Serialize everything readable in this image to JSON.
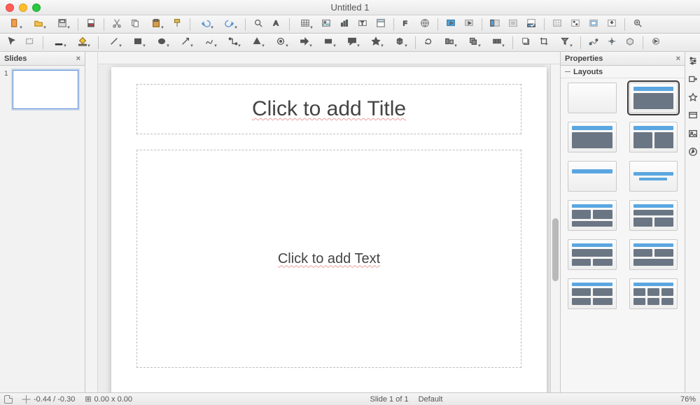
{
  "window": {
    "title": "Untitled 1"
  },
  "panels": {
    "slides": {
      "title": "Slides"
    },
    "properties": {
      "title": "Properties",
      "section": "Layouts"
    }
  },
  "slides": [
    {
      "number": "1"
    }
  ],
  "canvas": {
    "title_placeholder": "Click to add Title",
    "content_placeholder": "Click to add Text"
  },
  "layouts": [
    {
      "name": "blank",
      "selected": false
    },
    {
      "name": "title-content",
      "selected": true
    },
    {
      "name": "title-content-alt",
      "selected": false
    },
    {
      "name": "title-two-content",
      "selected": false
    },
    {
      "name": "title-only",
      "selected": false
    },
    {
      "name": "centered-text",
      "selected": false
    },
    {
      "name": "two-content-header",
      "selected": false
    },
    {
      "name": "two-content-header-alt",
      "selected": false
    },
    {
      "name": "content-over-two",
      "selected": false
    },
    {
      "name": "two-over-content",
      "selected": false
    },
    {
      "name": "four-content",
      "selected": false
    },
    {
      "name": "six-content",
      "selected": false
    }
  ],
  "statusbar": {
    "coords": "-0.44 / -0.30",
    "object_size": "0.00 x 0.00",
    "slide_info": "Slide 1 of 1",
    "master": "Default",
    "zoom": "76%"
  },
  "toolbar_row1": [
    {
      "name": "new-doc",
      "drop": true
    },
    {
      "name": "open",
      "drop": true
    },
    {
      "name": "save",
      "drop": true
    },
    {
      "sep": true
    },
    {
      "name": "export-pdf"
    },
    {
      "sep": true
    },
    {
      "name": "cut"
    },
    {
      "name": "copy"
    },
    {
      "name": "paste",
      "drop": true
    },
    {
      "name": "clone-format"
    },
    {
      "sep": true
    },
    {
      "name": "undo",
      "drop": true
    },
    {
      "name": "redo",
      "drop": true
    },
    {
      "sep": true
    },
    {
      "name": "find"
    },
    {
      "name": "char-dialog"
    },
    {
      "sep": true
    },
    {
      "name": "insert-table",
      "drop": true
    },
    {
      "name": "insert-image"
    },
    {
      "name": "insert-chart"
    },
    {
      "name": "insert-textbox"
    },
    {
      "name": "insert-header"
    },
    {
      "sep": true
    },
    {
      "name": "insert-fontwork"
    },
    {
      "name": "insert-hyperlink"
    },
    {
      "sep": true
    },
    {
      "name": "start-from-first"
    },
    {
      "name": "start-from-current"
    },
    {
      "sep": true
    },
    {
      "name": "views-normal"
    },
    {
      "name": "views-outline"
    },
    {
      "name": "views-notes"
    },
    {
      "sep": true
    },
    {
      "name": "display-grid"
    },
    {
      "name": "display-guides"
    },
    {
      "name": "display-snap"
    },
    {
      "name": "display-master"
    },
    {
      "sep": true
    },
    {
      "name": "zoom-tool"
    }
  ],
  "toolbar_row2": [
    {
      "name": "select-tool"
    },
    {
      "name": "zoom-pan"
    },
    {
      "sep": true
    },
    {
      "name": "line-color",
      "drop": true
    },
    {
      "name": "fill-color",
      "drop": true
    },
    {
      "sep": true
    },
    {
      "name": "line-tool",
      "drop": true
    },
    {
      "name": "rect-tool",
      "drop": true
    },
    {
      "name": "ellipse-tool",
      "drop": true
    },
    {
      "name": "arrow-line",
      "drop": true
    },
    {
      "name": "curves",
      "drop": true
    },
    {
      "name": "connectors",
      "drop": true
    },
    {
      "name": "basic-shapes",
      "drop": true
    },
    {
      "name": "symbol-shapes",
      "drop": true
    },
    {
      "name": "block-arrows",
      "drop": true
    },
    {
      "name": "flowchart",
      "drop": true
    },
    {
      "name": "callouts",
      "drop": true
    },
    {
      "name": "stars",
      "drop": true
    },
    {
      "name": "3d-objects",
      "drop": true
    },
    {
      "sep": true
    },
    {
      "name": "rotate"
    },
    {
      "name": "align-objects",
      "drop": true
    },
    {
      "name": "arrange",
      "drop": true
    },
    {
      "name": "distribute",
      "drop": true
    },
    {
      "sep": true
    },
    {
      "name": "shadow"
    },
    {
      "name": "crop"
    },
    {
      "name": "filter",
      "drop": true
    },
    {
      "sep": true
    },
    {
      "name": "points"
    },
    {
      "name": "glue"
    },
    {
      "name": "extrusion"
    },
    {
      "sep": true
    },
    {
      "name": "interaction"
    }
  ],
  "side_tools": [
    {
      "name": "properties"
    },
    {
      "name": "slide-transition"
    },
    {
      "name": "animation"
    },
    {
      "name": "master-slides"
    },
    {
      "name": "gallery"
    },
    {
      "name": "navigator"
    }
  ]
}
